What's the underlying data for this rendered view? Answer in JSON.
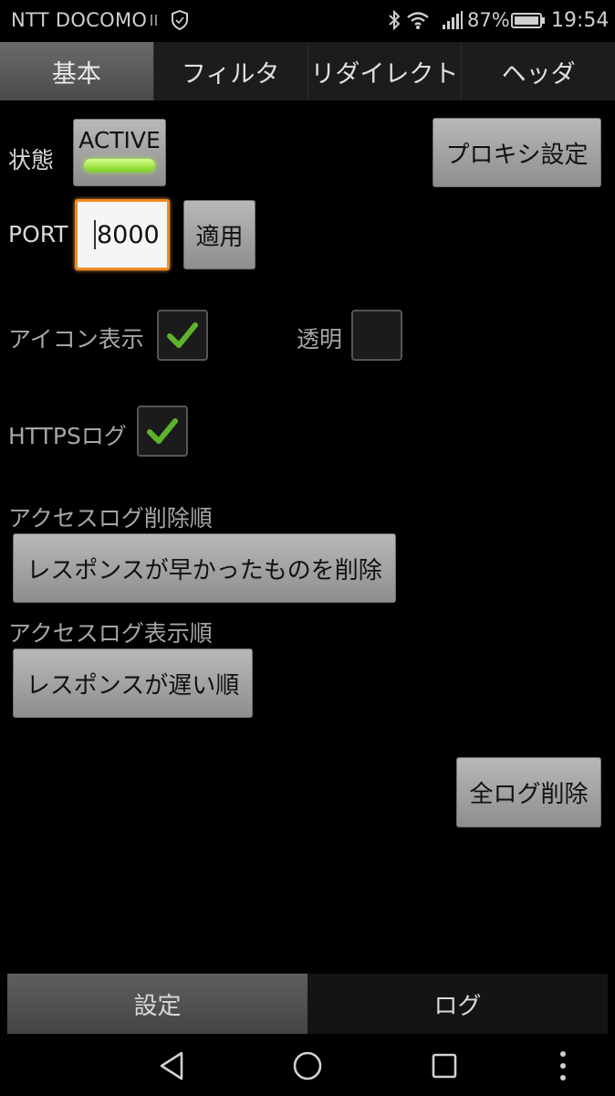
{
  "status_bar": {
    "carrier": "NTT DOCOMO",
    "battery_percent": "87%",
    "time": "19:54"
  },
  "tabs": [
    {
      "label": "基本",
      "active": true
    },
    {
      "label": "フィルタ",
      "active": false
    },
    {
      "label": "リダイレクト",
      "active": false
    },
    {
      "label": "ヘッダ",
      "active": false
    }
  ],
  "state": {
    "label": "状態",
    "toggle_label": "ACTIVE"
  },
  "proxy_settings_button": "プロキシ設定",
  "port": {
    "label": "PORT",
    "value": "8000",
    "apply_label": "適用"
  },
  "icon_display": {
    "label": "アイコン表示",
    "checked": true
  },
  "transparent": {
    "label": "透明",
    "checked": false
  },
  "https_log": {
    "label": "HTTPSログ",
    "checked": true
  },
  "access_log_delete_order": {
    "label": "アクセスログ削除順",
    "value": "レスポンスが早かったものを削除"
  },
  "access_log_display_order": {
    "label": "アクセスログ表示順",
    "value": "レスポンスが遅い順"
  },
  "delete_all_logs_button": "全ログ削除",
  "bottom_tabs": [
    {
      "label": "設定",
      "active": true
    },
    {
      "label": "ログ",
      "active": false
    }
  ],
  "colors": {
    "accent_orange": "#f08a1f",
    "check_green": "#5db32a",
    "active_led": "#9ef23f"
  }
}
